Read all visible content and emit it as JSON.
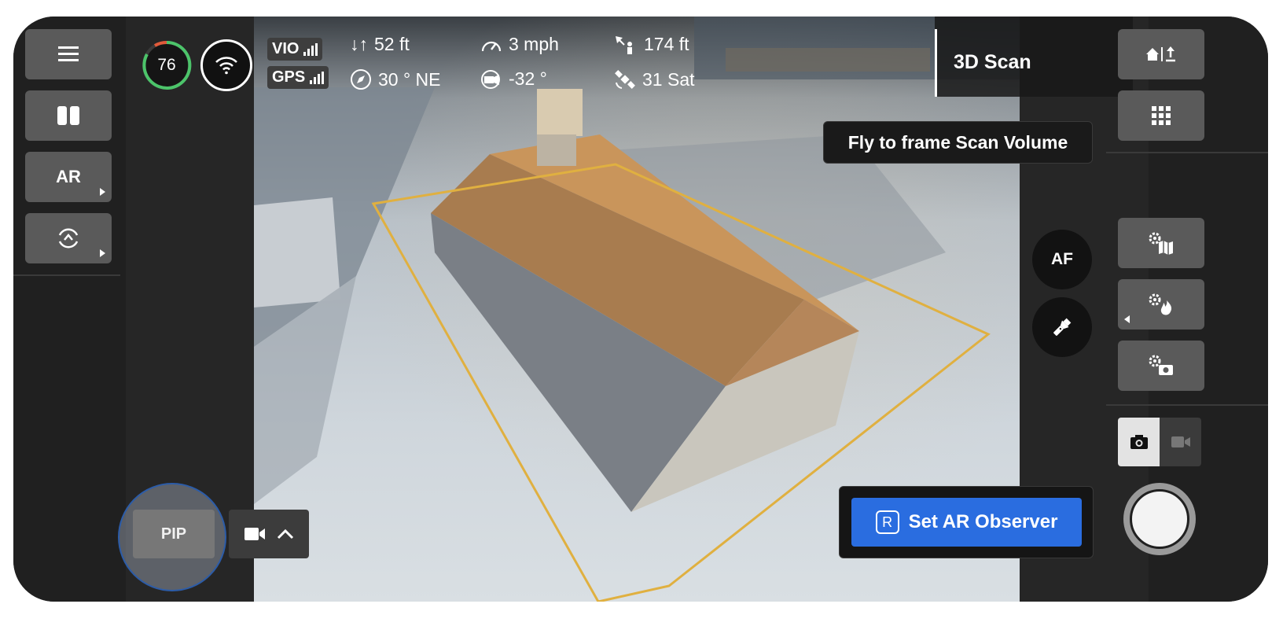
{
  "hud": {
    "battery": "76",
    "vio_label": "VIO",
    "gps_label": "GPS",
    "altitude": "52 ft",
    "heading": "30 ° NE",
    "speed": "3 mph",
    "gimbal_pitch": "-32 °",
    "distance": "174 ft",
    "satellites": "31 Sat",
    "mode_title": "3D Scan"
  },
  "left_rail": {
    "ar_label": "AR"
  },
  "tooltip": "Fly to frame Scan Volume",
  "camera_controls": {
    "af_label": "AF"
  },
  "observer": {
    "key_label": "R",
    "button_label": "Set AR Observer"
  },
  "bottom_left": {
    "pip_label": "PIP"
  },
  "colors": {
    "accent_blue": "#2a6de0",
    "scan_volume": "#e0b040",
    "battery_ring": "#4cc46a"
  }
}
